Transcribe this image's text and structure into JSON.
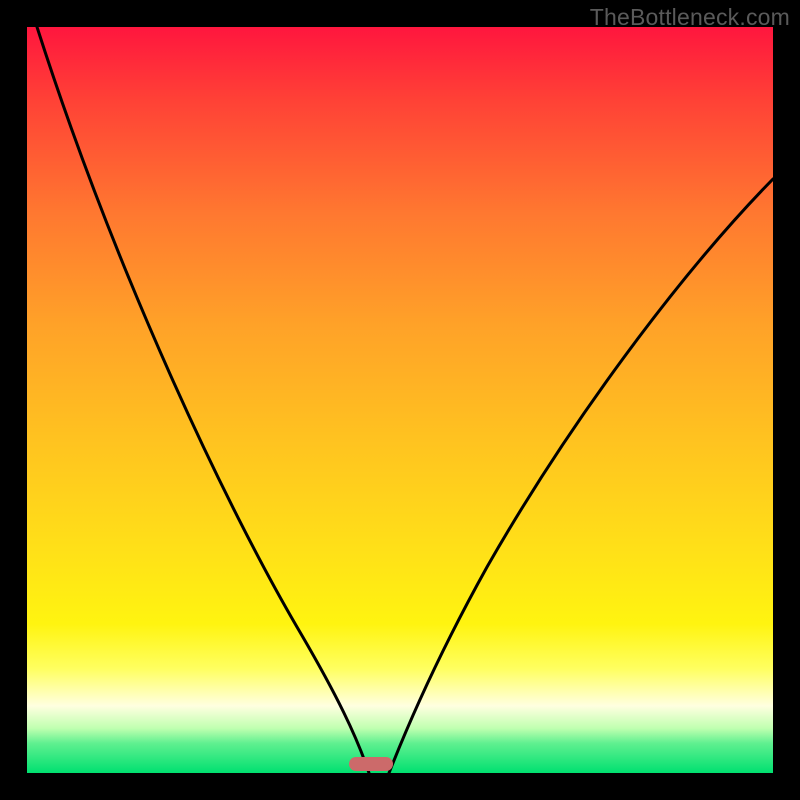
{
  "watermark": "TheBottleneck.com",
  "colors": {
    "page_bg": "#000000",
    "curve_stroke": "#000000",
    "marker": "#cc6a6a",
    "gradient_top": "#ff163e",
    "gradient_bottom": "#00e070"
  },
  "chart_data": {
    "type": "line",
    "title": "",
    "xlabel": "",
    "ylabel": "",
    "xlim": [
      0,
      100
    ],
    "ylim": [
      0,
      100
    ],
    "grid": false,
    "marker_x": 46,
    "marker_y": 0,
    "series": [
      {
        "name": "left-curve",
        "x": [
          0,
          5,
          10,
          15,
          20,
          25,
          30,
          35,
          40,
          44,
          46
        ],
        "y": [
          100,
          91,
          82,
          72,
          62,
          51,
          40,
          29,
          17,
          5,
          0
        ]
      },
      {
        "name": "right-curve",
        "x": [
          48,
          50,
          55,
          60,
          65,
          70,
          75,
          80,
          85,
          90,
          95,
          100
        ],
        "y": [
          0,
          6,
          18,
          29,
          38,
          46,
          53,
          60,
          65,
          71,
          75,
          80
        ]
      }
    ]
  }
}
